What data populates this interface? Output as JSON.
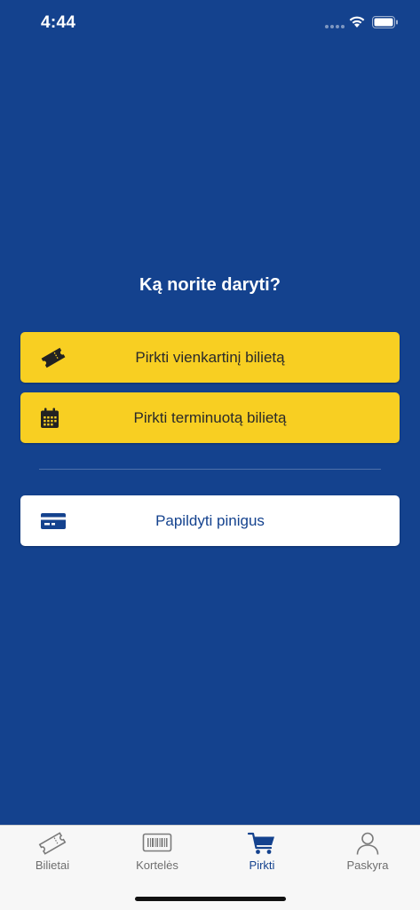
{
  "status_bar": {
    "time": "4:44"
  },
  "main": {
    "question": "Ką norite daryti?",
    "buttons": [
      {
        "label": "Pirkti vienkartinį bilietą",
        "icon": "ticket-icon"
      },
      {
        "label": "Pirkti terminuotą bilietą",
        "icon": "calendar-icon"
      },
      {
        "label": "Papildyti pinigus",
        "icon": "credit-card-icon"
      }
    ]
  },
  "colors": {
    "background": "#14428E",
    "accent_yellow": "#F8CF22",
    "active_tab": "#14428E",
    "inactive_tab": "#6E6E6E"
  },
  "tab_bar": {
    "active": "Pirkti",
    "tabs": [
      {
        "label": "Bilietai",
        "icon": "ticket-outline-icon"
      },
      {
        "label": "Kortelės",
        "icon": "barcode-card-icon"
      },
      {
        "label": "Pirkti",
        "icon": "cart-icon"
      },
      {
        "label": "Paskyra",
        "icon": "user-icon"
      }
    ]
  }
}
